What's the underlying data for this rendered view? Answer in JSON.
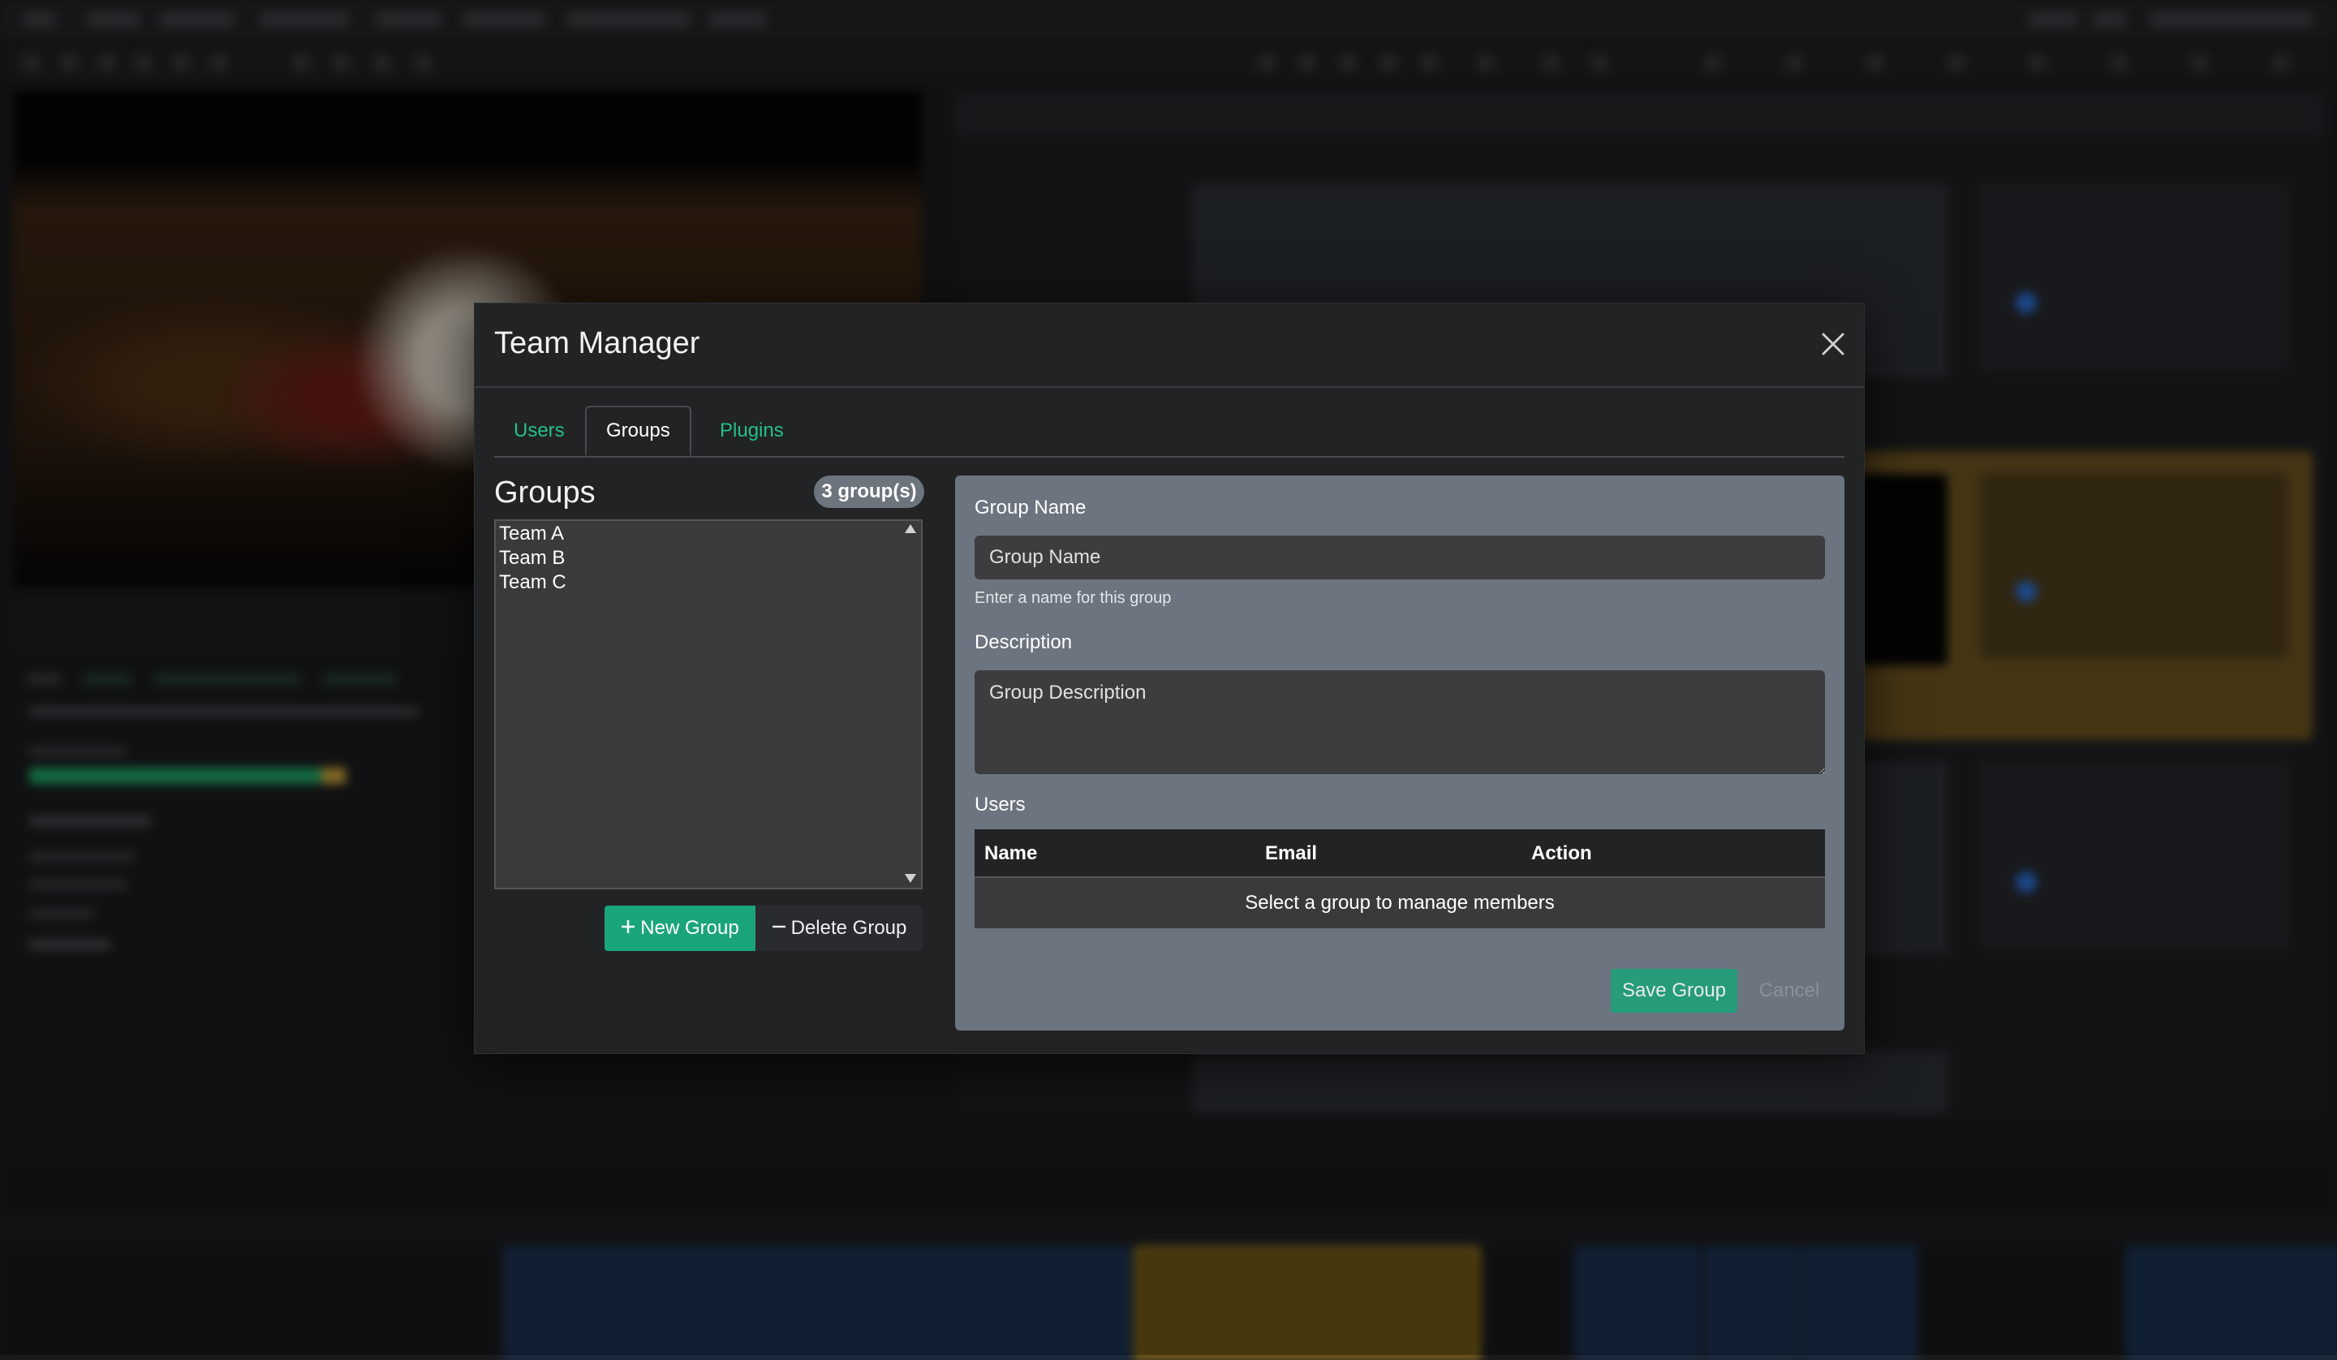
{
  "modal": {
    "title": "Team Manager",
    "tabs": [
      {
        "label": "Users",
        "active": false
      },
      {
        "label": "Groups",
        "active": true
      },
      {
        "label": "Plugins",
        "active": false
      }
    ]
  },
  "groups_panel": {
    "title": "Groups",
    "count_badge": "3 group(s)",
    "items": [
      "Team A",
      "Team B",
      "Team C"
    ],
    "new_button": "New Group",
    "delete_button": "Delete Group"
  },
  "form": {
    "name_label": "Group Name",
    "name_placeholder": "Group Name",
    "name_help": "Enter a name for this group",
    "description_label": "Description",
    "description_placeholder": "Group Description",
    "users_label": "Users",
    "table_headers": [
      "Name",
      "Email",
      "Action"
    ],
    "empty_message": "Select a group to manage members",
    "save_button": "Save Group",
    "cancel_button": "Cancel"
  },
  "colors": {
    "accent": "#1aa47a",
    "tab_link": "#24c08a",
    "form_panel": "#6c7480",
    "badge": "#6c757d"
  },
  "icons": [
    "close-icon",
    "plus-icon",
    "minus-icon",
    "scroll-up-icon",
    "scroll-down-icon"
  ]
}
